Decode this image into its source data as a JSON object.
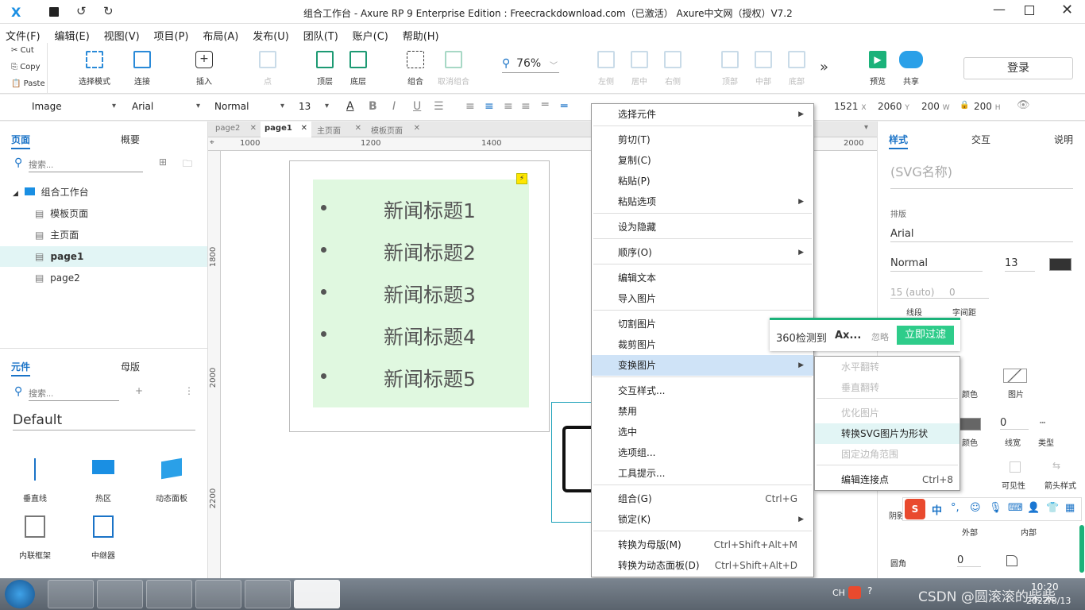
{
  "titlebar": {
    "title": "组合工作台 - Axure RP 9 Enterprise Edition : Freecrackdownload.com（已激活）  Axure中文网（授权）V7.2"
  },
  "menubar": {
    "items": [
      "文件(F)",
      "编辑(E)",
      "视图(V)",
      "项目(P)",
      "布局(A)",
      "发布(U)",
      "团队(T)",
      "账户(C)",
      "帮助(H)"
    ]
  },
  "clipboard": {
    "cut": "Cut",
    "copy": "Copy",
    "paste": "Paste"
  },
  "toolbar": {
    "select_mode": "选择模式",
    "connect": "连接",
    "insert": "插入",
    "point": "点",
    "top": "顶层",
    "bottom": "底层",
    "group": "组合",
    "ungroup": "取消组合",
    "zoom": "76%",
    "align_left": "左侧",
    "align_center": "居中",
    "align_right": "右侧",
    "align_top": "顶部",
    "align_middle": "中部",
    "align_bottom": "底部",
    "preview": "预览",
    "share": "共享",
    "login": "登录"
  },
  "format": {
    "element_type": "Image",
    "font": "Arial",
    "weight": "Normal",
    "size": "13",
    "x": "1521",
    "x_label": "X",
    "y": "2060",
    "y_label": "Y",
    "w": "200",
    "w_label": "W",
    "h": "200",
    "h_label": "H"
  },
  "pages_panel": {
    "tabs": [
      "页面",
      "概要"
    ],
    "search_placeholder": "搜索...",
    "tree": [
      {
        "label": "组合工作台",
        "type": "folder"
      },
      {
        "label": "模板页面",
        "type": "page"
      },
      {
        "label": "主页面",
        "type": "page"
      },
      {
        "label": "page1",
        "type": "page",
        "selected": true
      },
      {
        "label": "page2",
        "type": "page"
      }
    ]
  },
  "library_panel": {
    "tabs": [
      "元件",
      "母版"
    ],
    "search_placeholder": "搜索...",
    "library": "Default",
    "widgets": [
      "垂直线",
      "热区",
      "动态面板",
      "内联框架",
      "中继器"
    ]
  },
  "doc_tabs": [
    "page2",
    "page1",
    "主页面",
    "模板页面"
  ],
  "ruler": {
    "h": [
      "1000",
      "1200",
      "1400",
      "2000"
    ],
    "v": [
      "1800",
      "2000",
      "2200"
    ]
  },
  "canvas": {
    "news": [
      "新闻标题1",
      "新闻标题2",
      "新闻标题3",
      "新闻标题4",
      "新闻标题5"
    ]
  },
  "context_menu": {
    "items": [
      {
        "label": "选择元件",
        "submenu": true
      },
      {
        "label": "剪切(T)"
      },
      {
        "label": "复制(C)"
      },
      {
        "label": "粘贴(P)"
      },
      {
        "label": "粘贴选项",
        "submenu": true
      },
      {
        "label": "设为隐藏"
      },
      {
        "label": "顺序(O)",
        "submenu": true
      },
      {
        "label": "编辑文本"
      },
      {
        "label": "导入图片"
      },
      {
        "label": "切割图片"
      },
      {
        "label": "裁剪图片"
      },
      {
        "label": "变换图片",
        "submenu": true
      },
      {
        "label": "交互样式..."
      },
      {
        "label": "禁用"
      },
      {
        "label": "选中"
      },
      {
        "label": "选项组..."
      },
      {
        "label": "工具提示..."
      },
      {
        "label": "组合(G)",
        "shortcut": "Ctrl+G"
      },
      {
        "label": "锁定(K)",
        "submenu": true
      },
      {
        "label": "转换为母版(M)",
        "shortcut": "Ctrl+Shift+Alt+M"
      },
      {
        "label": "转换为动态面板(D)",
        "shortcut": "Ctrl+Shift+Alt+D"
      }
    ]
  },
  "submenu": {
    "items": [
      {
        "label": "水平翻转",
        "disabled": true
      },
      {
        "label": "垂直翻转",
        "disabled": true
      },
      {
        "label": "优化图片",
        "disabled": true
      },
      {
        "label": "转换SVG图片为形状",
        "disabled": false
      },
      {
        "label": "固定边角范围",
        "disabled": true
      },
      {
        "label": "编辑连接点",
        "shortcut": "Ctrl+8",
        "disabled": false
      }
    ]
  },
  "popup_360": {
    "text": "360检测到",
    "name": "Ax...",
    "ignore": "忽略",
    "action": "立即过滤"
  },
  "inspector": {
    "tabs": [
      "样式",
      "交互",
      "说明"
    ],
    "name_placeholder": "(SVG名称)",
    "section": "排版",
    "font": "Arial",
    "weight": "Normal",
    "size": "13",
    "line_height": "15 (auto)",
    "char_spacing": "0",
    "line_label": "线段",
    "spacing_label": "字间距",
    "fill_label": "颜色",
    "image_label": "图片",
    "border_color_label": "颜色",
    "border_width": "0",
    "border_width_label": "线宽",
    "border_type_label": "类型",
    "visibility_label": "可见性",
    "arrow_label": "箭头样式",
    "shadow_label": "阴影",
    "outer_label": "外部",
    "inner_label": "内部",
    "corner_label": "圆角",
    "corner_value": "0"
  },
  "taskbar": {
    "lang": "CH",
    "time": "10:20",
    "date": "2022/8/13",
    "watermark": "CSDN @圆滚滚的柴柴"
  }
}
